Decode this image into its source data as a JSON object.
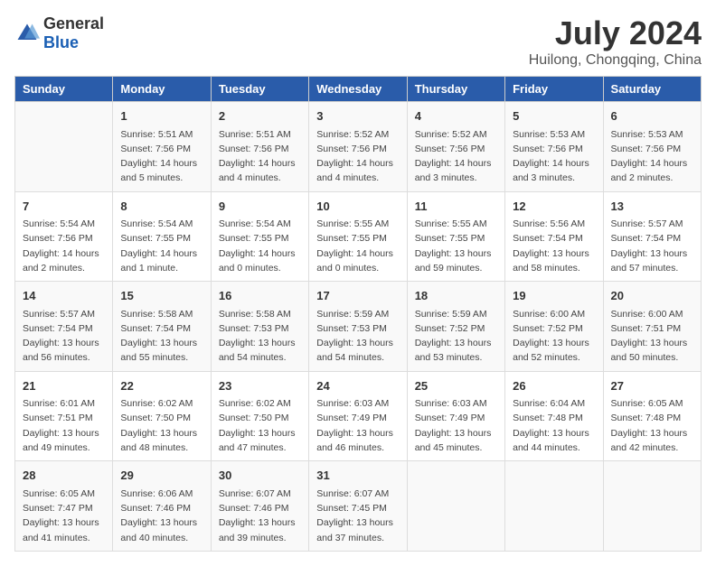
{
  "logo": {
    "general": "General",
    "blue": "Blue"
  },
  "title": "July 2024",
  "subtitle": "Huilong, Chongqing, China",
  "headers": [
    "Sunday",
    "Monday",
    "Tuesday",
    "Wednesday",
    "Thursday",
    "Friday",
    "Saturday"
  ],
  "weeks": [
    [
      {
        "day": "",
        "info": ""
      },
      {
        "day": "1",
        "info": "Sunrise: 5:51 AM\nSunset: 7:56 PM\nDaylight: 14 hours\nand 5 minutes."
      },
      {
        "day": "2",
        "info": "Sunrise: 5:51 AM\nSunset: 7:56 PM\nDaylight: 14 hours\nand 4 minutes."
      },
      {
        "day": "3",
        "info": "Sunrise: 5:52 AM\nSunset: 7:56 PM\nDaylight: 14 hours\nand 4 minutes."
      },
      {
        "day": "4",
        "info": "Sunrise: 5:52 AM\nSunset: 7:56 PM\nDaylight: 14 hours\nand 3 minutes."
      },
      {
        "day": "5",
        "info": "Sunrise: 5:53 AM\nSunset: 7:56 PM\nDaylight: 14 hours\nand 3 minutes."
      },
      {
        "day": "6",
        "info": "Sunrise: 5:53 AM\nSunset: 7:56 PM\nDaylight: 14 hours\nand 2 minutes."
      }
    ],
    [
      {
        "day": "7",
        "info": "Sunrise: 5:54 AM\nSunset: 7:56 PM\nDaylight: 14 hours\nand 2 minutes."
      },
      {
        "day": "8",
        "info": "Sunrise: 5:54 AM\nSunset: 7:55 PM\nDaylight: 14 hours\nand 1 minute."
      },
      {
        "day": "9",
        "info": "Sunrise: 5:54 AM\nSunset: 7:55 PM\nDaylight: 14 hours\nand 0 minutes."
      },
      {
        "day": "10",
        "info": "Sunrise: 5:55 AM\nSunset: 7:55 PM\nDaylight: 14 hours\nand 0 minutes."
      },
      {
        "day": "11",
        "info": "Sunrise: 5:55 AM\nSunset: 7:55 PM\nDaylight: 13 hours\nand 59 minutes."
      },
      {
        "day": "12",
        "info": "Sunrise: 5:56 AM\nSunset: 7:54 PM\nDaylight: 13 hours\nand 58 minutes."
      },
      {
        "day": "13",
        "info": "Sunrise: 5:57 AM\nSunset: 7:54 PM\nDaylight: 13 hours\nand 57 minutes."
      }
    ],
    [
      {
        "day": "14",
        "info": "Sunrise: 5:57 AM\nSunset: 7:54 PM\nDaylight: 13 hours\nand 56 minutes."
      },
      {
        "day": "15",
        "info": "Sunrise: 5:58 AM\nSunset: 7:54 PM\nDaylight: 13 hours\nand 55 minutes."
      },
      {
        "day": "16",
        "info": "Sunrise: 5:58 AM\nSunset: 7:53 PM\nDaylight: 13 hours\nand 54 minutes."
      },
      {
        "day": "17",
        "info": "Sunrise: 5:59 AM\nSunset: 7:53 PM\nDaylight: 13 hours\nand 54 minutes."
      },
      {
        "day": "18",
        "info": "Sunrise: 5:59 AM\nSunset: 7:52 PM\nDaylight: 13 hours\nand 53 minutes."
      },
      {
        "day": "19",
        "info": "Sunrise: 6:00 AM\nSunset: 7:52 PM\nDaylight: 13 hours\nand 52 minutes."
      },
      {
        "day": "20",
        "info": "Sunrise: 6:00 AM\nSunset: 7:51 PM\nDaylight: 13 hours\nand 50 minutes."
      }
    ],
    [
      {
        "day": "21",
        "info": "Sunrise: 6:01 AM\nSunset: 7:51 PM\nDaylight: 13 hours\nand 49 minutes."
      },
      {
        "day": "22",
        "info": "Sunrise: 6:02 AM\nSunset: 7:50 PM\nDaylight: 13 hours\nand 48 minutes."
      },
      {
        "day": "23",
        "info": "Sunrise: 6:02 AM\nSunset: 7:50 PM\nDaylight: 13 hours\nand 47 minutes."
      },
      {
        "day": "24",
        "info": "Sunrise: 6:03 AM\nSunset: 7:49 PM\nDaylight: 13 hours\nand 46 minutes."
      },
      {
        "day": "25",
        "info": "Sunrise: 6:03 AM\nSunset: 7:49 PM\nDaylight: 13 hours\nand 45 minutes."
      },
      {
        "day": "26",
        "info": "Sunrise: 6:04 AM\nSunset: 7:48 PM\nDaylight: 13 hours\nand 44 minutes."
      },
      {
        "day": "27",
        "info": "Sunrise: 6:05 AM\nSunset: 7:48 PM\nDaylight: 13 hours\nand 42 minutes."
      }
    ],
    [
      {
        "day": "28",
        "info": "Sunrise: 6:05 AM\nSunset: 7:47 PM\nDaylight: 13 hours\nand 41 minutes."
      },
      {
        "day": "29",
        "info": "Sunrise: 6:06 AM\nSunset: 7:46 PM\nDaylight: 13 hours\nand 40 minutes."
      },
      {
        "day": "30",
        "info": "Sunrise: 6:07 AM\nSunset: 7:46 PM\nDaylight: 13 hours\nand 39 minutes."
      },
      {
        "day": "31",
        "info": "Sunrise: 6:07 AM\nSunset: 7:45 PM\nDaylight: 13 hours\nand 37 minutes."
      },
      {
        "day": "",
        "info": ""
      },
      {
        "day": "",
        "info": ""
      },
      {
        "day": "",
        "info": ""
      }
    ]
  ]
}
